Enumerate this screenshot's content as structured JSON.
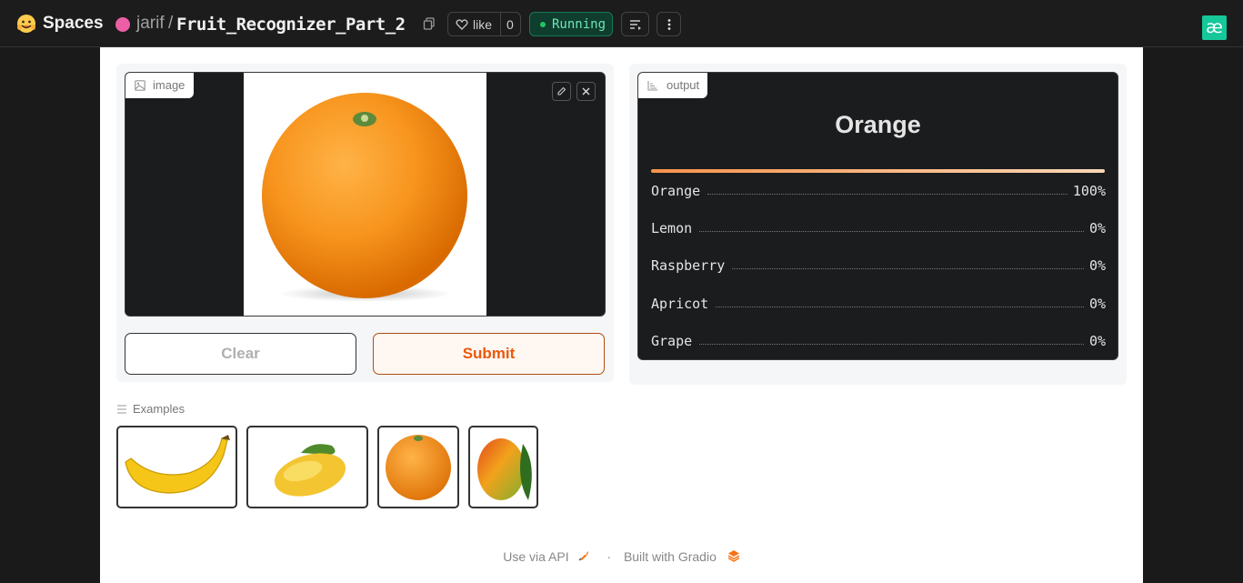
{
  "header": {
    "spaces_label": "Spaces",
    "owner": "jarif",
    "separator": "/",
    "repo_name": "Fruit_Recognizer_Part_2",
    "like_label": "like",
    "like_count": "0",
    "status": "Running",
    "status_color": "#22c55e",
    "right_logo_text": "æ"
  },
  "input": {
    "label": "image",
    "image_subject": "orange",
    "clear_label": "Clear",
    "submit_label": "Submit",
    "submit_color": "#ea580c"
  },
  "output": {
    "label": "output",
    "top_label": "Orange",
    "confidences": [
      {
        "label": "Orange",
        "value": "100%"
      },
      {
        "label": "Lemon",
        "value": "0%"
      },
      {
        "label": "Raspberry",
        "value": "0%"
      },
      {
        "label": "Apricot",
        "value": "0%"
      },
      {
        "label": "Grape",
        "value": "0%"
      }
    ]
  },
  "examples": {
    "label": "Examples",
    "items": [
      {
        "subject": "banana"
      },
      {
        "subject": "mango"
      },
      {
        "subject": "orange"
      },
      {
        "subject": "mango"
      }
    ]
  },
  "footer": {
    "api_label": "Use via API",
    "dot": "·",
    "built_label": "Built with Gradio"
  }
}
